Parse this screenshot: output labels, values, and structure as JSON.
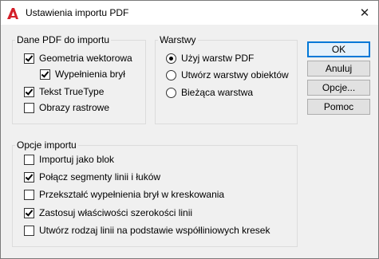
{
  "window": {
    "title": "Ustawienia importu PDF"
  },
  "pdf_data_group": {
    "legend": "Dane PDF do importu",
    "items": [
      {
        "label": "Geometria wektorowa",
        "checked": true
      },
      {
        "label": "Wypełnienia brył",
        "checked": true
      },
      {
        "label": "Tekst TrueType",
        "checked": true
      },
      {
        "label": "Obrazy rastrowe",
        "checked": false
      }
    ]
  },
  "layers_group": {
    "legend": "Warstwy",
    "options": [
      {
        "label": "Użyj warstw PDF",
        "selected": true
      },
      {
        "label": "Utwórz warstwy obiektów",
        "selected": false
      },
      {
        "label": "Bieżąca warstwa",
        "selected": false
      }
    ]
  },
  "import_options_group": {
    "legend": "Opcje importu",
    "items": [
      {
        "label": "Importuj jako blok",
        "checked": false
      },
      {
        "label": "Połącz segmenty linii i łuków",
        "checked": true
      },
      {
        "label": "Przekształć wypełnienia brył w kreskowania",
        "checked": false
      },
      {
        "label": "Zastosuj właściwości szerokości linii",
        "checked": true
      },
      {
        "label": "Utwórz rodzaj linii na podstawie współliniowych kresek",
        "checked": false
      }
    ]
  },
  "buttons": {
    "ok": "OK",
    "cancel": "Anuluj",
    "options": "Opcje...",
    "help": "Pomoc"
  },
  "colors": {
    "accent": "#0078d7",
    "app_icon": "#d4202a"
  }
}
